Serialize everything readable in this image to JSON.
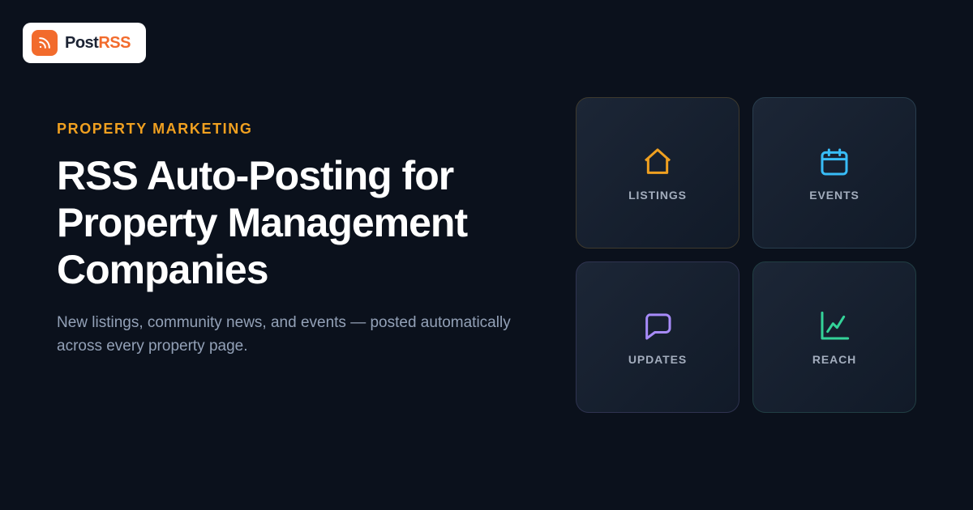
{
  "brand": {
    "name_part1": "Post",
    "name_part2": "RSS",
    "icon": "rss-icon",
    "accent_color": "#f26b2c"
  },
  "hero": {
    "eyebrow": "PROPERTY MARKETING",
    "eyebrow_color": "#f0a020",
    "headline": "RSS Auto-Posting for Property Management Companies",
    "subtitle": "New listings, community news, and events — posted automatically across every property page."
  },
  "cards": [
    {
      "label": "LISTINGS",
      "icon": "house-icon",
      "color": "#f0a020"
    },
    {
      "label": "EVENTS",
      "icon": "calendar-icon",
      "color": "#38bdf8"
    },
    {
      "label": "UPDATES",
      "icon": "chat-bubble-icon",
      "color": "#a78bfa"
    },
    {
      "label": "REACH",
      "icon": "line-chart-icon",
      "color": "#34d399"
    }
  ],
  "colors": {
    "background": "#0b111c",
    "headline": "#ffffff",
    "subtitle": "#93a1b7"
  }
}
